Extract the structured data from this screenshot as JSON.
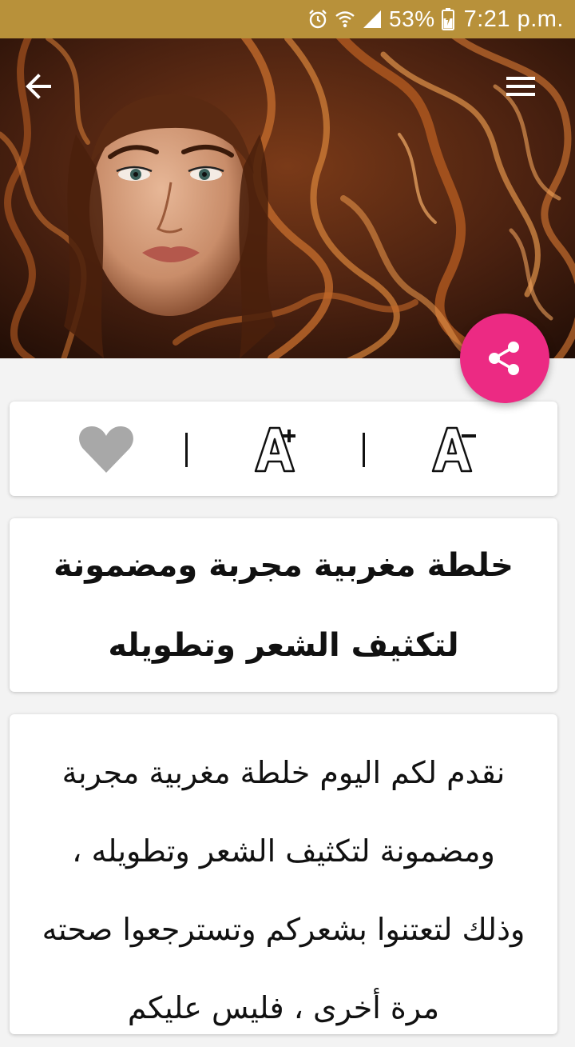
{
  "status_bar": {
    "battery_percent": "53%",
    "time": "7:21 p.m."
  },
  "header": {
    "back_icon": "arrow-left-icon",
    "menu_icon": "hamburger-menu-icon"
  },
  "share_button": {
    "icon": "share-icon",
    "color": "#ec2a83"
  },
  "toolbar": {
    "favorite_icon": "heart-icon",
    "increase_font_label": "A+",
    "decrease_font_label": "A-"
  },
  "article": {
    "title": "خلطة مغربية مجربة ومضمونة لتكثيف الشعر وتطويله",
    "body": "نقدم لكم اليوم خلطة مغربية مجربة ومضمونة لتكثيف الشعر وتطويله ، وذلك لتعتنوا بشعركم وتسترجعوا صحته مرة أخرى ، فليس عليكم"
  },
  "colors": {
    "status_bar": "#b8913a",
    "accent": "#ec2a83",
    "background": "#f3f3f3"
  }
}
